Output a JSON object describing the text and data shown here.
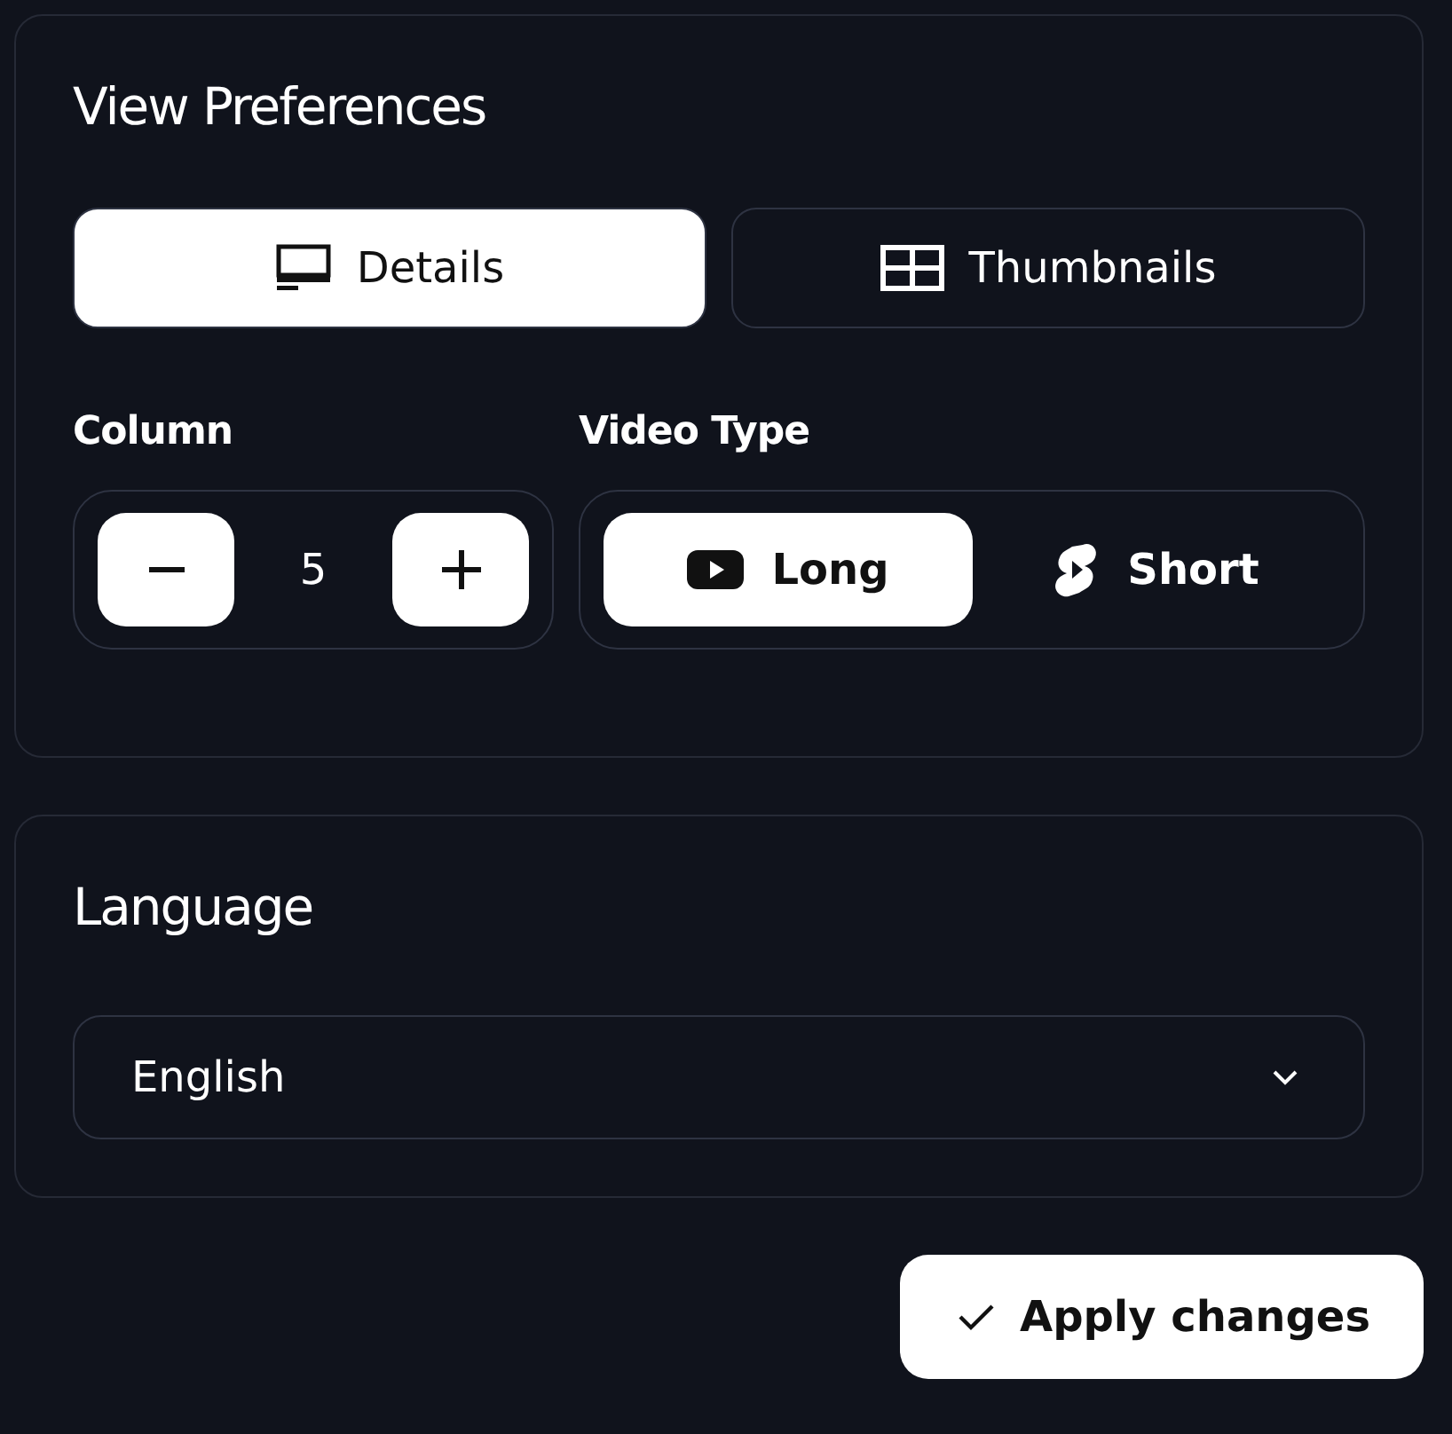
{
  "view_preferences": {
    "title": "View Preferences",
    "view_modes": [
      {
        "label": "Details",
        "selected": true
      },
      {
        "label": "Thumbnails",
        "selected": false
      }
    ],
    "column": {
      "label": "Column",
      "value": "5"
    },
    "video_type": {
      "label": "Video Type",
      "options": [
        {
          "label": "Long",
          "selected": true
        },
        {
          "label": "Short",
          "selected": false
        }
      ]
    }
  },
  "language": {
    "title": "Language",
    "select": {
      "value": "English"
    }
  },
  "apply_button": {
    "label": "Apply changes"
  }
}
